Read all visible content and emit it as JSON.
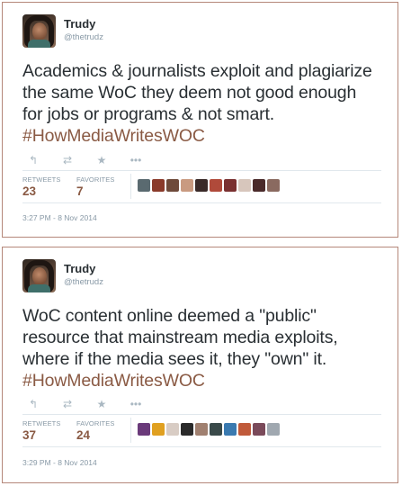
{
  "tweets": [
    {
      "name": "Trudy",
      "handle": "@thetrudz",
      "text_lines": [
        "Academics & journalists exploit and plagiarize",
        "the same WoC they deem not good enough",
        "for jobs or programs & not smart."
      ],
      "hashtag": "#HowMediaWritesWOC",
      "retweets_label": "RETWEETS",
      "retweets": "23",
      "favorites_label": "FAVORITES",
      "favorites": "7",
      "timestamp": "3:27 PM - 8 Nov 2014",
      "favoriter_colors": [
        "#5a6a70",
        "#8a3a2a",
        "#6e4a3a",
        "#c99a80",
        "#3a2a28",
        "#b04a3a",
        "#7a3030",
        "#d7c6bc",
        "#4a2a2a",
        "#8a6a60"
      ]
    },
    {
      "name": "Trudy",
      "handle": "@thetrudz",
      "text_lines": [
        "WoC content online deemed a \"public\"",
        "resource that mainstream media exploits,",
        "where if the media sees it, they \"own\" it."
      ],
      "hashtag": "#HowMediaWritesWOC",
      "retweets_label": "RETWEETS",
      "retweets": "37",
      "favorites_label": "FAVORITES",
      "favorites": "24",
      "timestamp": "3:29 PM - 8 Nov 2014",
      "favoriter_colors": [
        "#6a3a7a",
        "#e0a020",
        "#d8ccc4",
        "#2a2a2a",
        "#a08070",
        "#3a4a4a",
        "#3a7ab0",
        "#c05a3a",
        "#7a4a5a",
        "#a0a8b0"
      ]
    }
  ],
  "icons": {
    "reply": "reply-icon",
    "retweet": "retweet-icon",
    "favorite": "star-icon",
    "more": "more-icon"
  }
}
